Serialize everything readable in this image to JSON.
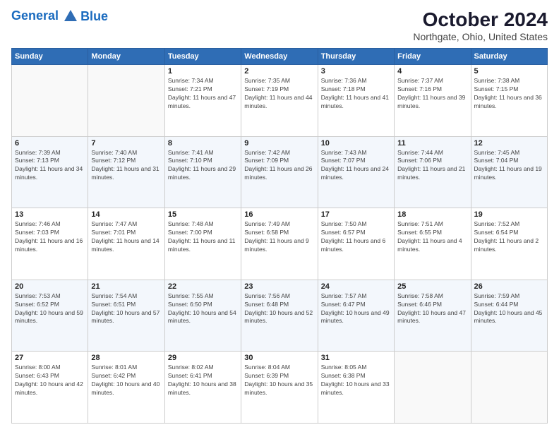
{
  "header": {
    "logo_line1": "General",
    "logo_line2": "Blue",
    "title": "October 2024",
    "subtitle": "Northgate, Ohio, United States"
  },
  "days_of_week": [
    "Sunday",
    "Monday",
    "Tuesday",
    "Wednesday",
    "Thursday",
    "Friday",
    "Saturday"
  ],
  "weeks": [
    [
      {
        "day": "",
        "info": ""
      },
      {
        "day": "",
        "info": ""
      },
      {
        "day": "1",
        "info": "Sunrise: 7:34 AM\nSunset: 7:21 PM\nDaylight: 11 hours and 47 minutes."
      },
      {
        "day": "2",
        "info": "Sunrise: 7:35 AM\nSunset: 7:19 PM\nDaylight: 11 hours and 44 minutes."
      },
      {
        "day": "3",
        "info": "Sunrise: 7:36 AM\nSunset: 7:18 PM\nDaylight: 11 hours and 41 minutes."
      },
      {
        "day": "4",
        "info": "Sunrise: 7:37 AM\nSunset: 7:16 PM\nDaylight: 11 hours and 39 minutes."
      },
      {
        "day": "5",
        "info": "Sunrise: 7:38 AM\nSunset: 7:15 PM\nDaylight: 11 hours and 36 minutes."
      }
    ],
    [
      {
        "day": "6",
        "info": "Sunrise: 7:39 AM\nSunset: 7:13 PM\nDaylight: 11 hours and 34 minutes."
      },
      {
        "day": "7",
        "info": "Sunrise: 7:40 AM\nSunset: 7:12 PM\nDaylight: 11 hours and 31 minutes."
      },
      {
        "day": "8",
        "info": "Sunrise: 7:41 AM\nSunset: 7:10 PM\nDaylight: 11 hours and 29 minutes."
      },
      {
        "day": "9",
        "info": "Sunrise: 7:42 AM\nSunset: 7:09 PM\nDaylight: 11 hours and 26 minutes."
      },
      {
        "day": "10",
        "info": "Sunrise: 7:43 AM\nSunset: 7:07 PM\nDaylight: 11 hours and 24 minutes."
      },
      {
        "day": "11",
        "info": "Sunrise: 7:44 AM\nSunset: 7:06 PM\nDaylight: 11 hours and 21 minutes."
      },
      {
        "day": "12",
        "info": "Sunrise: 7:45 AM\nSunset: 7:04 PM\nDaylight: 11 hours and 19 minutes."
      }
    ],
    [
      {
        "day": "13",
        "info": "Sunrise: 7:46 AM\nSunset: 7:03 PM\nDaylight: 11 hours and 16 minutes."
      },
      {
        "day": "14",
        "info": "Sunrise: 7:47 AM\nSunset: 7:01 PM\nDaylight: 11 hours and 14 minutes."
      },
      {
        "day": "15",
        "info": "Sunrise: 7:48 AM\nSunset: 7:00 PM\nDaylight: 11 hours and 11 minutes."
      },
      {
        "day": "16",
        "info": "Sunrise: 7:49 AM\nSunset: 6:58 PM\nDaylight: 11 hours and 9 minutes."
      },
      {
        "day": "17",
        "info": "Sunrise: 7:50 AM\nSunset: 6:57 PM\nDaylight: 11 hours and 6 minutes."
      },
      {
        "day": "18",
        "info": "Sunrise: 7:51 AM\nSunset: 6:55 PM\nDaylight: 11 hours and 4 minutes."
      },
      {
        "day": "19",
        "info": "Sunrise: 7:52 AM\nSunset: 6:54 PM\nDaylight: 11 hours and 2 minutes."
      }
    ],
    [
      {
        "day": "20",
        "info": "Sunrise: 7:53 AM\nSunset: 6:52 PM\nDaylight: 10 hours and 59 minutes."
      },
      {
        "day": "21",
        "info": "Sunrise: 7:54 AM\nSunset: 6:51 PM\nDaylight: 10 hours and 57 minutes."
      },
      {
        "day": "22",
        "info": "Sunrise: 7:55 AM\nSunset: 6:50 PM\nDaylight: 10 hours and 54 minutes."
      },
      {
        "day": "23",
        "info": "Sunrise: 7:56 AM\nSunset: 6:48 PM\nDaylight: 10 hours and 52 minutes."
      },
      {
        "day": "24",
        "info": "Sunrise: 7:57 AM\nSunset: 6:47 PM\nDaylight: 10 hours and 49 minutes."
      },
      {
        "day": "25",
        "info": "Sunrise: 7:58 AM\nSunset: 6:46 PM\nDaylight: 10 hours and 47 minutes."
      },
      {
        "day": "26",
        "info": "Sunrise: 7:59 AM\nSunset: 6:44 PM\nDaylight: 10 hours and 45 minutes."
      }
    ],
    [
      {
        "day": "27",
        "info": "Sunrise: 8:00 AM\nSunset: 6:43 PM\nDaylight: 10 hours and 42 minutes."
      },
      {
        "day": "28",
        "info": "Sunrise: 8:01 AM\nSunset: 6:42 PM\nDaylight: 10 hours and 40 minutes."
      },
      {
        "day": "29",
        "info": "Sunrise: 8:02 AM\nSunset: 6:41 PM\nDaylight: 10 hours and 38 minutes."
      },
      {
        "day": "30",
        "info": "Sunrise: 8:04 AM\nSunset: 6:39 PM\nDaylight: 10 hours and 35 minutes."
      },
      {
        "day": "31",
        "info": "Sunrise: 8:05 AM\nSunset: 6:38 PM\nDaylight: 10 hours and 33 minutes."
      },
      {
        "day": "",
        "info": ""
      },
      {
        "day": "",
        "info": ""
      }
    ]
  ]
}
